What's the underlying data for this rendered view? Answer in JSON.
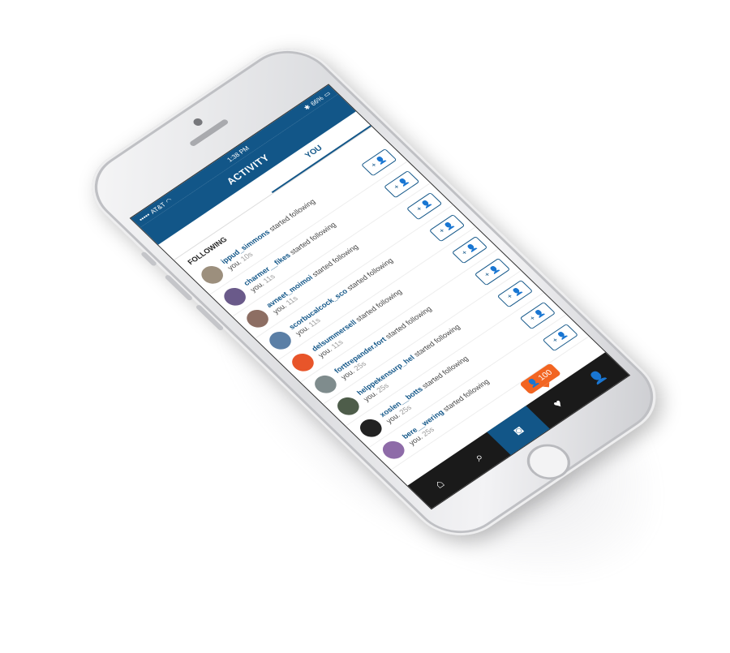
{
  "status_bar": {
    "carrier": "AT&T",
    "time": "1:38 PM",
    "battery": "66%"
  },
  "header": {
    "title": "ACTIVITY"
  },
  "tabs": [
    {
      "label": "",
      "active": false
    },
    {
      "label": "YOU",
      "active": true
    }
  ],
  "section": {
    "title": "FOLLOWING"
  },
  "follow_button_label": "+ 👤",
  "activity": [
    {
      "username": "ippud_simmons",
      "action": "started following",
      "target": "you.",
      "time": "10s",
      "avatar_color": "#9c8f7d"
    },
    {
      "username": "charmer__fikes",
      "action": "started following",
      "target": "you.",
      "time": "11s",
      "avatar_color": "#6a5a8a"
    },
    {
      "username": "avneet_moimoi",
      "action": "started following",
      "target": "you.",
      "time": "11s",
      "avatar_color": "#8d6e63"
    },
    {
      "username": "scorbucalcock_sco",
      "action": "started following",
      "target": "you.",
      "time": "11s",
      "avatar_color": "#5b7fa6"
    },
    {
      "username": "delsummersell",
      "action": "started following",
      "target": "you.",
      "time": "11s",
      "avatar_color": "#e8552a"
    },
    {
      "username": "forttrepander.fort",
      "action": "started following",
      "target": "you.",
      "time": "25s",
      "avatar_color": "#7f8c8d"
    },
    {
      "username": "helppekensurp_hel",
      "action": "started following",
      "target": "you.",
      "time": "25s",
      "avatar_color": "#4e5d4a"
    },
    {
      "username": "xoslen__botts",
      "action": "started following",
      "target": "you.",
      "time": "25s",
      "avatar_color": "#222222"
    },
    {
      "username": "bere__wering",
      "action": "started following",
      "target": "you.",
      "time": "25s",
      "avatar_color": "#8e6ba8"
    }
  ],
  "tab_bar": {
    "items": [
      {
        "icon": "home-icon",
        "glyph": "⌂"
      },
      {
        "icon": "search-icon",
        "glyph": "⌕"
      },
      {
        "icon": "camera-icon",
        "glyph": "◙"
      },
      {
        "icon": "activity-icon",
        "glyph": "♥"
      },
      {
        "icon": "profile-icon",
        "glyph": "👤"
      }
    ]
  },
  "notification": {
    "count": "100",
    "icon": "follower-icon"
  }
}
